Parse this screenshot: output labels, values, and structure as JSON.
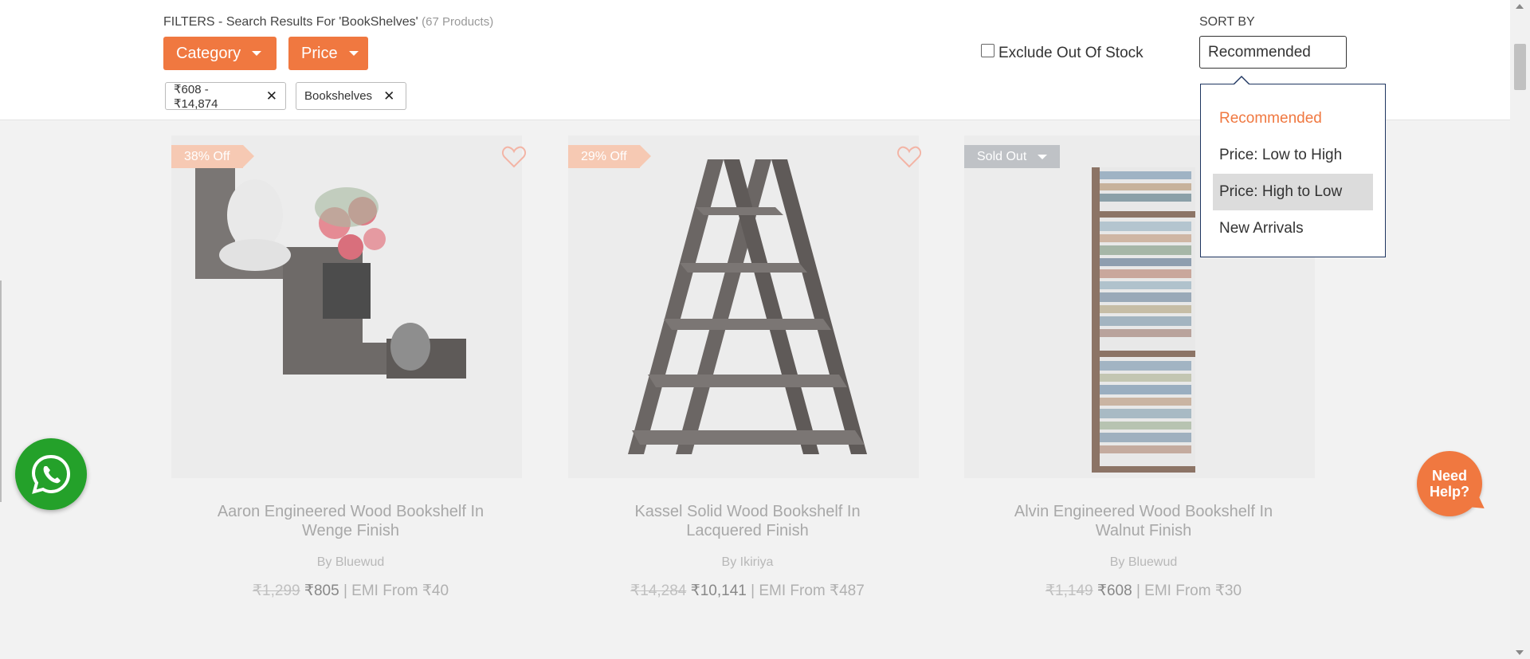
{
  "filters": {
    "heading": "FILTERS - Search Results For 'BookShelves'",
    "count": "(67 Products)",
    "category_label": "Category",
    "price_label": "Price",
    "chips": [
      {
        "label": "₹608 - ₹14,874"
      },
      {
        "label": "Bookshelves"
      }
    ],
    "exclude_label": "Exclude Out Of Stock",
    "exclude_checked": false
  },
  "sort": {
    "label": "SORT BY",
    "selected": "Recommended",
    "options": [
      {
        "label": "Recommended",
        "active": true
      },
      {
        "label": "Price: Low to High"
      },
      {
        "label": "Price: High to Low",
        "hovered": true
      },
      {
        "label": "New Arrivals"
      }
    ]
  },
  "products": [
    {
      "badge": "38% Off",
      "title": "Aaron Engineered Wood Bookshelf In Wenge Finish",
      "brand": "By Bluewud",
      "mrp": "₹1,299",
      "price": "₹805",
      "emi": "| EMI From ₹40"
    },
    {
      "badge": "29% Off",
      "title": "Kassel Solid Wood Bookshelf In Lacquered Finish",
      "brand": "By Ikiriya",
      "mrp": "₹14,284",
      "price": "₹10,141",
      "emi": "| EMI From ₹487"
    },
    {
      "badge": "Sold Out",
      "title": "Alvin Engineered Wood Bookshelf In Walnut Finish",
      "brand": "By Bluewud",
      "mrp": "₹1,149",
      "price": "₹608",
      "emi": "| EMI From ₹30"
    }
  ],
  "help": {
    "line1": "Need",
    "line2": "Help?"
  },
  "colors": {
    "accent": "#f07840",
    "whatsapp": "#24a12a"
  }
}
